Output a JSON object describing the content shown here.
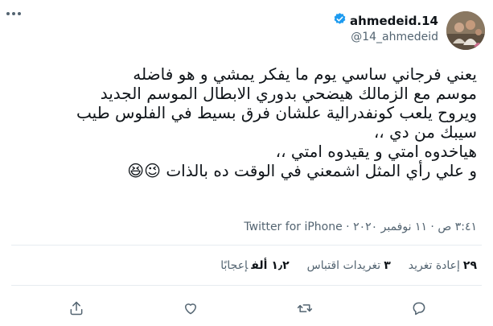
{
  "user": {
    "display_name": "ahmedeid.14",
    "handle": "@14_ahmedeid"
  },
  "tweet": {
    "lines": [
      "يعني فرجاني ساسي يوم ما يفكر يمشي و هو فاضله",
      "موسم مع الزمالك هيضحي بدوري الابطال الموسم الجديد",
      "ويروح يلعب كونفدرالية علشان فرق بسيط في الفلوس طيب",
      "سيبك من دي ،،",
      "هياخدوه امتي و يقيدوه امتي ،،",
      "و علي رأي المثل اشمعني في الوقت ده بالذات 😉😆"
    ],
    "time": "٣:٤١ ص · ١١ نوفمبر ٢٠٢٠ · ",
    "source": "Twitter for iPhone"
  },
  "stats": {
    "retweets_count": "٢٩",
    "retweets_label": "إعادة تغريد",
    "quotes_count": "٣",
    "quotes_label": "تغريدات اقتباس",
    "likes_count": "١٫٢ ألف",
    "likes_label": "إعجابًا"
  },
  "colors": {
    "verified": "#1d9bf0",
    "muted": "#536471",
    "divider": "#e6ecf0"
  }
}
